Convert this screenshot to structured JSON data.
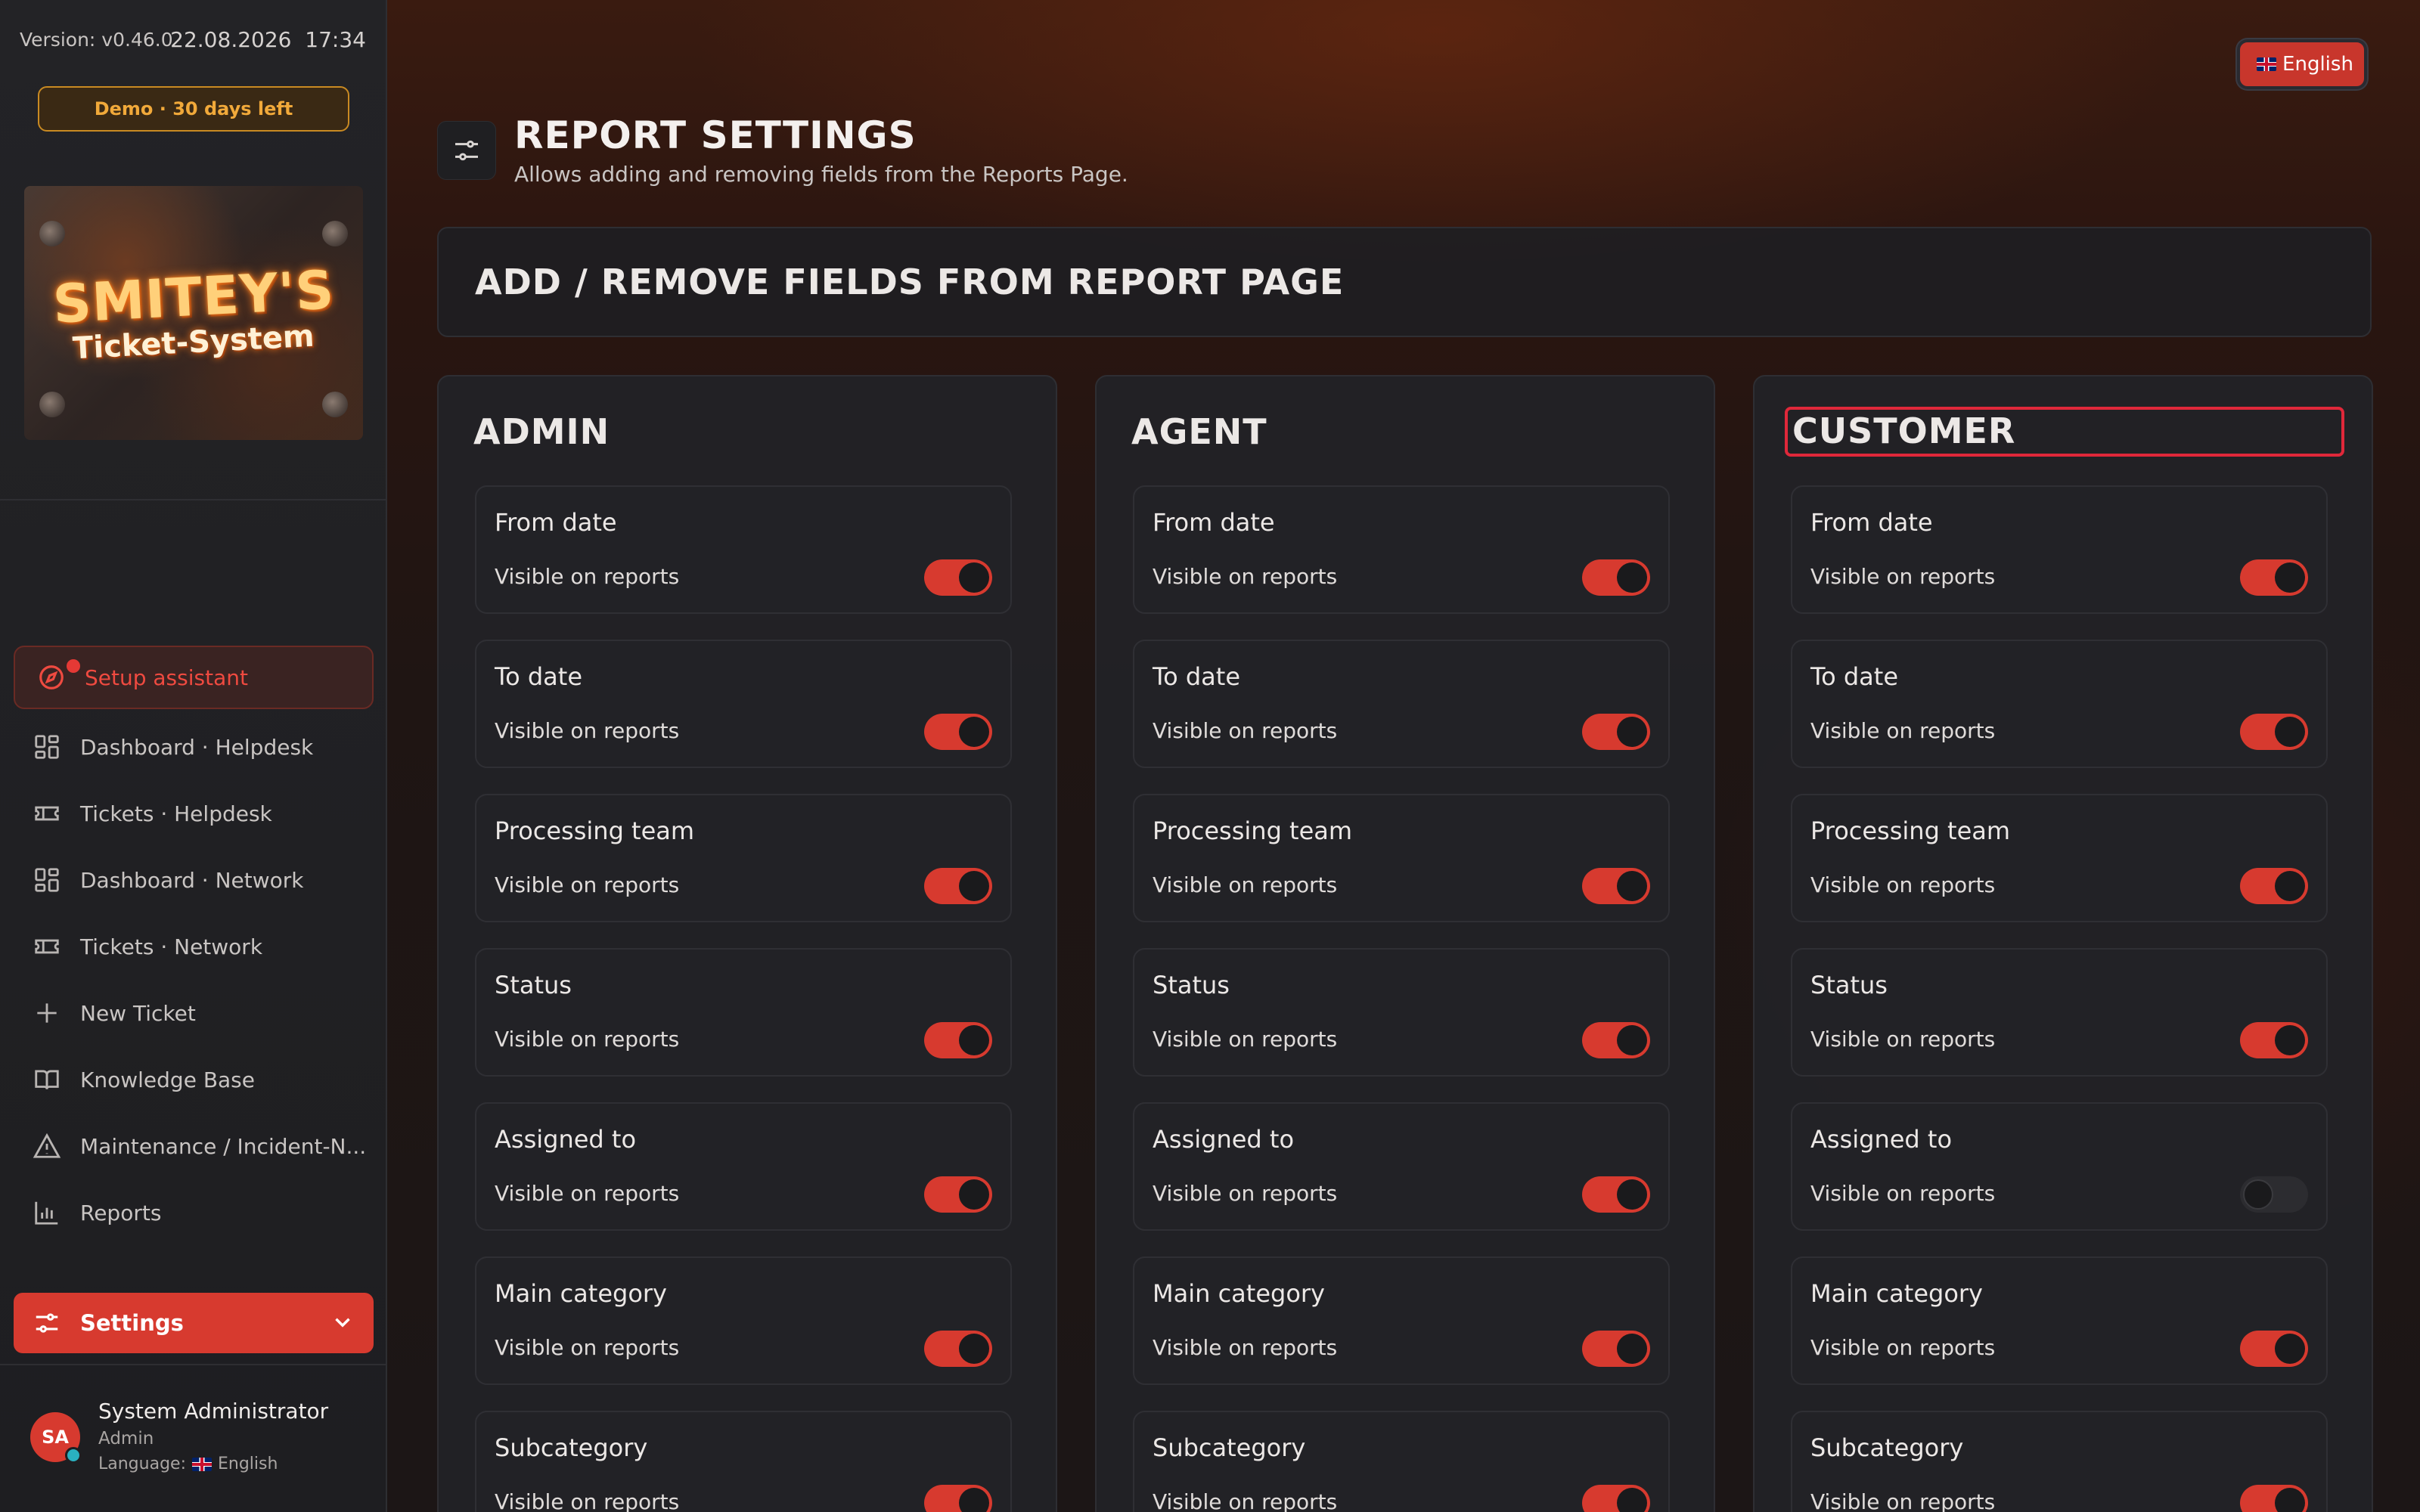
{
  "sidebar": {
    "version": "Version: v0.46.0",
    "date": "22.08.2026",
    "time": "17:34",
    "demo_badge": "Demo · 30 days left",
    "logo": {
      "title": "SMITEY'S",
      "subtitle": "Ticket-System"
    },
    "setup_assistant": "Setup assistant",
    "nav_items": [
      {
        "label": "Dashboard · Helpdesk",
        "icon": "dashboard-grid-icon"
      },
      {
        "label": "Tickets · Helpdesk",
        "icon": "ticket-icon"
      },
      {
        "label": "Dashboard · Network",
        "icon": "dashboard-grid-icon"
      },
      {
        "label": "Tickets · Network",
        "icon": "ticket-icon"
      },
      {
        "label": "New Ticket",
        "icon": "plus-icon"
      },
      {
        "label": "Knowledge Base",
        "icon": "book-icon"
      },
      {
        "label": "Maintenance / Incident-N...",
        "icon": "warning-icon"
      },
      {
        "label": "Reports",
        "icon": "bar-chart-icon"
      }
    ],
    "settings": "Settings",
    "user": {
      "initials": "SA",
      "name": "System Administrator",
      "role": "Admin",
      "language_label": "Language:",
      "language": "English"
    }
  },
  "header": {
    "language_button": "English",
    "title": "REPORT SETTINGS",
    "subtitle": "Allows adding and removing fields from the Reports Page."
  },
  "section_title": "ADD / REMOVE FIELDS FROM REPORT PAGE",
  "toggle_sublabel": "Visible on reports",
  "roles": [
    {
      "title": "ADMIN",
      "fields": [
        {
          "name": "From date",
          "visible": true
        },
        {
          "name": "To date",
          "visible": true
        },
        {
          "name": "Processing team",
          "visible": true
        },
        {
          "name": "Status",
          "visible": true
        },
        {
          "name": "Assigned to",
          "visible": true
        },
        {
          "name": "Main category",
          "visible": true
        },
        {
          "name": "Subcategory",
          "visible": true
        }
      ]
    },
    {
      "title": "AGENT",
      "fields": [
        {
          "name": "From date",
          "visible": true
        },
        {
          "name": "To date",
          "visible": true
        },
        {
          "name": "Processing team",
          "visible": true
        },
        {
          "name": "Status",
          "visible": true
        },
        {
          "name": "Assigned to",
          "visible": true
        },
        {
          "name": "Main category",
          "visible": true
        },
        {
          "name": "Subcategory",
          "visible": true
        }
      ]
    },
    {
      "title": "CUSTOMER",
      "fields": [
        {
          "name": "From date",
          "visible": true
        },
        {
          "name": "To date",
          "visible": true
        },
        {
          "name": "Processing team",
          "visible": true
        },
        {
          "name": "Status",
          "visible": true
        },
        {
          "name": "Assigned to",
          "visible": false
        },
        {
          "name": "Main category",
          "visible": true
        },
        {
          "name": "Subcategory",
          "visible": true
        }
      ]
    }
  ],
  "colors": {
    "accent": "#d73a2f",
    "demo_badge": "#f1a93a",
    "focus_outline": "#e0283a"
  }
}
